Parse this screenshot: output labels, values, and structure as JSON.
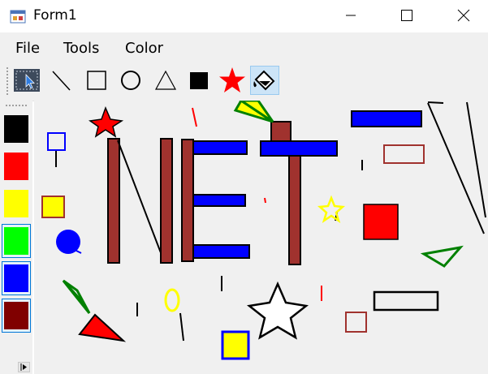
{
  "window": {
    "title": "Form1",
    "icon": "form-app-icon",
    "controls": [
      "minimize-icon",
      "maximize-icon",
      "close-icon"
    ]
  },
  "menu": {
    "file": "File",
    "tools": "Tools",
    "color": "Color"
  },
  "toolbar": {
    "tools": [
      "select-pointer-icon",
      "line-icon",
      "rectangle-icon",
      "circle-icon",
      "triangle-icon",
      "filled-square-icon",
      "star-icon",
      "fill-bucket-icon"
    ],
    "active_tool": "fill-bucket-icon"
  },
  "palette": {
    "colors": [
      "#000000",
      "#ff0000",
      "#ffff00",
      "#00ff00",
      "#0000ff",
      "#800000"
    ],
    "selected": [
      "#00ff00",
      "#0000ff",
      "#800000"
    ]
  },
  "canvas": {
    "background": "#f0f0f0"
  }
}
